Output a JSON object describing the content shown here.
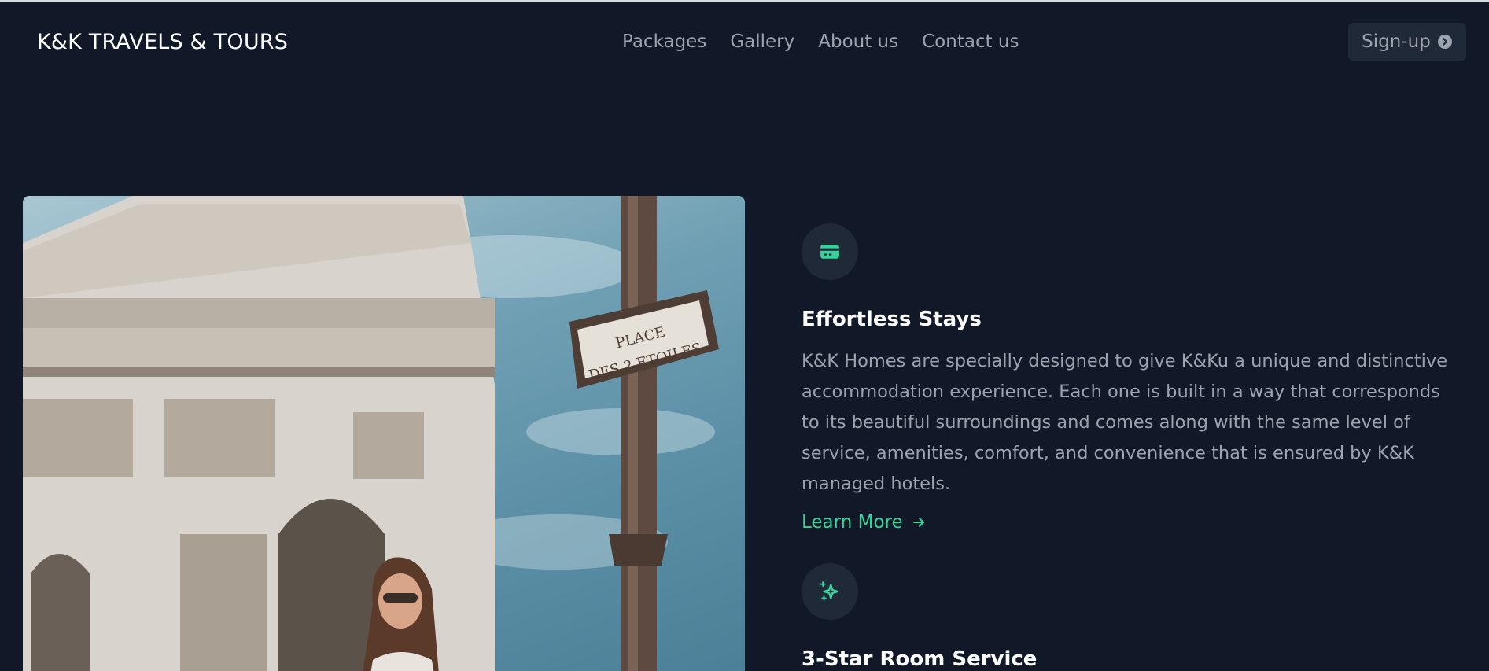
{
  "header": {
    "brand": "K&K TRAVELS & TOURS",
    "nav": [
      "Packages",
      "Gallery",
      "About us",
      "Contact us"
    ],
    "signup_label": "Sign-up"
  },
  "hero_image": {
    "sign_line1": "PLACE",
    "sign_line2": "DES 2 ETOILES"
  },
  "features": [
    {
      "icon": "credit-card-icon",
      "title": "Effortless Stays",
      "description": "K&K Homes are specially designed to give K&Ku a unique and distinctive accommodation experience. Each one is built in a way that corresponds to its beautiful surroundings and comes along with the same level of service, amenities, comfort, and convenience that is ensured by K&K managed hotels.",
      "link_label": "Learn More"
    },
    {
      "icon": "sparkles-icon",
      "title": "3-Star Room Service"
    }
  ],
  "colors": {
    "background": "#111827",
    "surface": "#1f2937",
    "accent": "#34d399",
    "muted_text": "#9ca3af"
  }
}
